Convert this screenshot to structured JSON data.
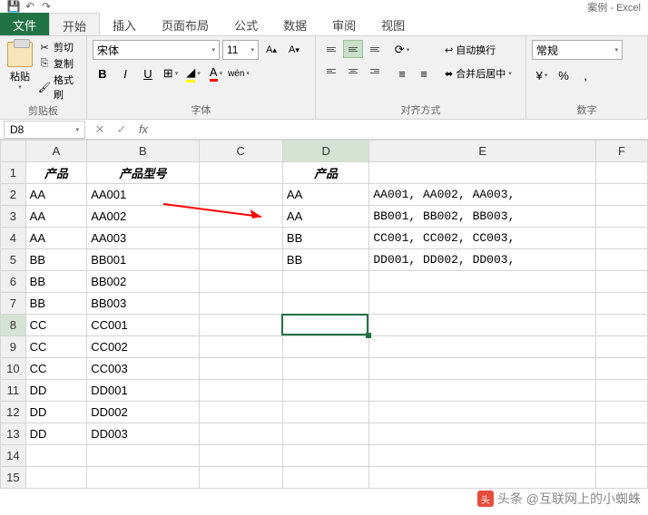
{
  "title": "案例 - Excel",
  "qat": {
    "save": "save",
    "undo": "undo",
    "redo": "redo"
  },
  "tabs": {
    "file": "文件",
    "items": [
      "开始",
      "插入",
      "页面布局",
      "公式",
      "数据",
      "审阅",
      "视图"
    ],
    "active": 0
  },
  "ribbon": {
    "clipboard": {
      "paste": "粘贴",
      "cut": "剪切",
      "copy": "复制",
      "format_painter": "格式刷",
      "label": "剪贴板"
    },
    "font": {
      "name": "宋体",
      "size": "11",
      "bold": "B",
      "italic": "I",
      "underline": "U",
      "label": "字体",
      "inc": "A",
      "dec": "A",
      "phonetic": "wén"
    },
    "align": {
      "wrap": "自动换行",
      "merge": "合并后居中",
      "label": "对齐方式"
    },
    "number": {
      "format": "常规",
      "label": "数字",
      "percent": "%",
      "comma": ","
    }
  },
  "namebox": "D8",
  "columns": [
    "A",
    "B",
    "C",
    "D",
    "E",
    "F"
  ],
  "headers": {
    "A": "产品",
    "B": "产品型号",
    "D": "产品"
  },
  "rows": [
    {
      "A": "AA",
      "B": "AA001",
      "D": "AA",
      "E": "AA001, AA002, AA003,"
    },
    {
      "A": "AA",
      "B": "AA002",
      "D": "AA",
      "E": "BB001, BB002, BB003,"
    },
    {
      "A": "AA",
      "B": "AA003",
      "D": "BB",
      "E": "CC001, CC002, CC003,"
    },
    {
      "A": "BB",
      "B": "BB001",
      "D": "BB",
      "E": "DD001, DD002, DD003,"
    },
    {
      "A": "BB",
      "B": "BB002"
    },
    {
      "A": "BB",
      "B": "BB003"
    },
    {
      "A": "CC",
      "B": "CC001"
    },
    {
      "A": "CC",
      "B": "CC002"
    },
    {
      "A": "CC",
      "B": "CC003"
    },
    {
      "A": "DD",
      "B": "DD001"
    },
    {
      "A": "DD",
      "B": "DD002"
    },
    {
      "A": "DD",
      "B": "DD003"
    },
    {},
    {}
  ],
  "selected": {
    "row": 8,
    "col": "D"
  },
  "watermark": "头条 @互联网上的小蜘蛛"
}
